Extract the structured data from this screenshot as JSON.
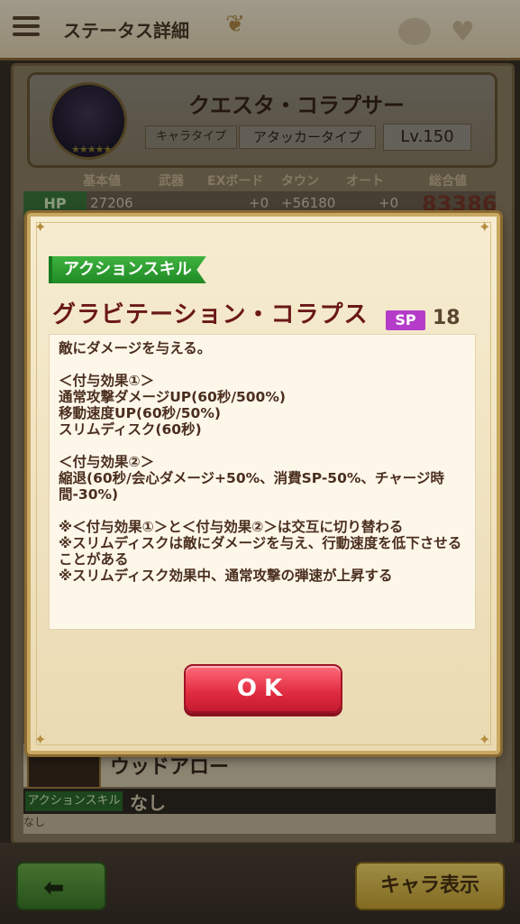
{
  "header": {
    "title": "ステータス詳細"
  },
  "character": {
    "name": "クエスタ・コラプサー",
    "type_label": "キャラタイプ",
    "type_value": "アタッカータイプ",
    "level": "Lv.150",
    "stars": "★★★★★"
  },
  "stats": {
    "columns": [
      "基本値",
      "武器",
      "EXボード",
      "タウン",
      "オート",
      "総合値"
    ],
    "hp": {
      "label": "HP",
      "values": [
        "27206",
        "",
        "+0",
        "+56180",
        "+0"
      ],
      "total": "83386"
    }
  },
  "lower": {
    "weapon_name": "ウッドアロー",
    "skill_label": "アクションスキル",
    "skill_value": "なし",
    "skill_desc": "なし"
  },
  "bottom": {
    "chara_button": "キャラ表示"
  },
  "modal": {
    "tag": "アクションスキル",
    "skill_name": "グラビテーション・コラプス",
    "sp_label": "SP",
    "sp_value": "18",
    "description": "敵にダメージを与える。\n\n＜付与効果①＞\n通常攻撃ダメージUP(60秒/500%)\n移動速度UP(60秒/50%)\nスリムディスク(60秒)\n\n＜付与効果②＞\n縮退(60秒/会心ダメージ+50%、消費SP-50%、チャージ時間-30%)\n\n※＜付与効果①＞と＜付与効果②＞は交互に切り替わる\n※スリムディスクは敵にダメージを与え、行動速度を低下させることがある\n※スリムディスク効果中、通常攻撃の弾速が上昇する",
    "ok_label": "OK"
  }
}
